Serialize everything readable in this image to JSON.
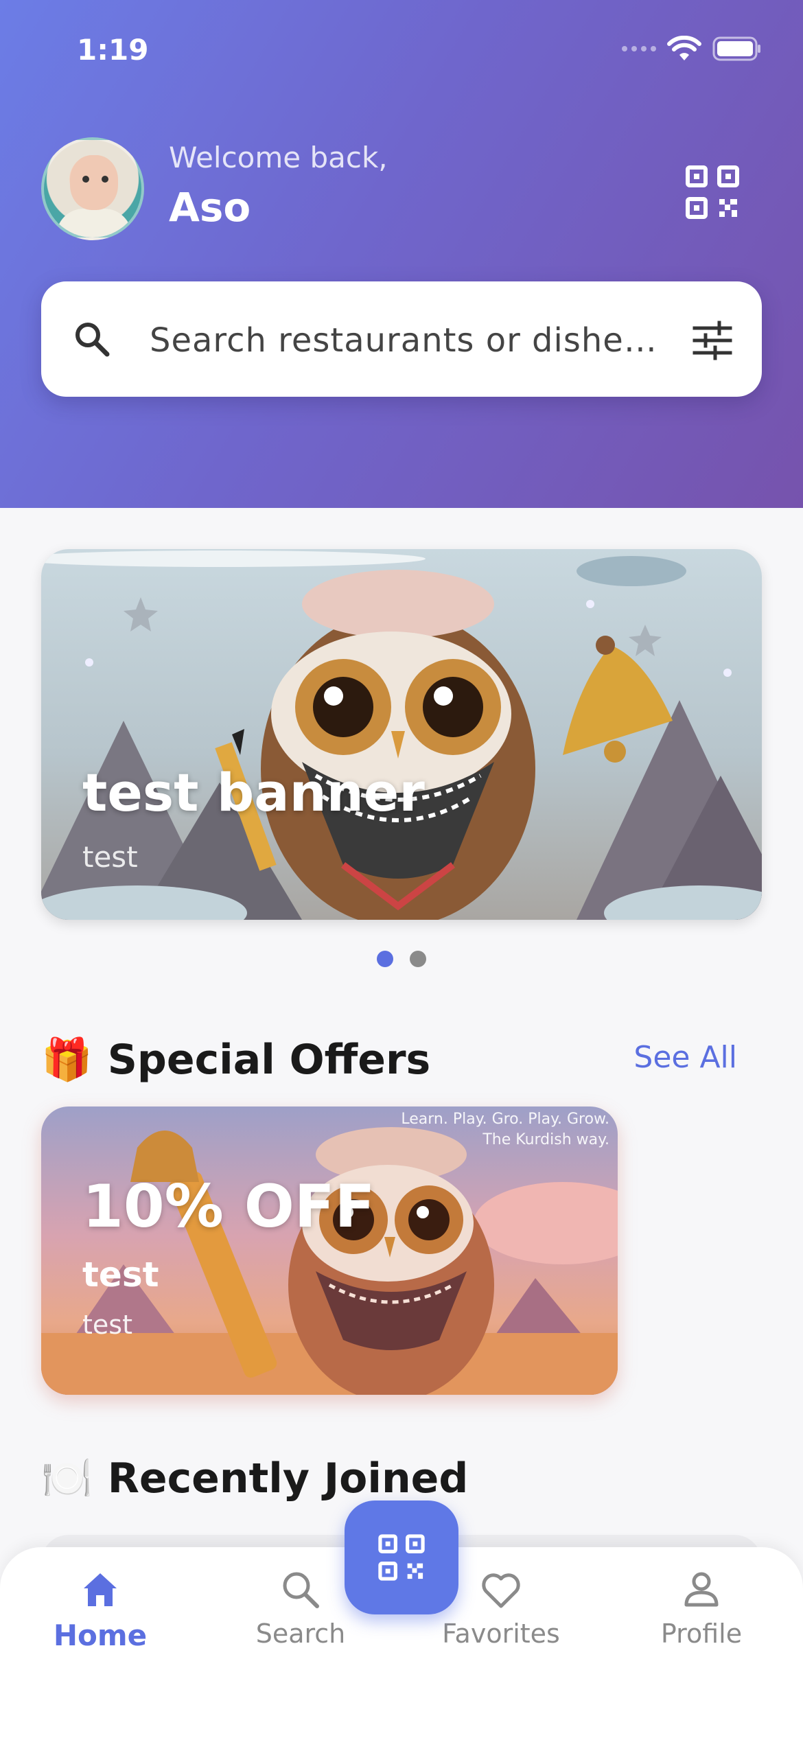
{
  "status_bar": {
    "time": "1:19"
  },
  "header": {
    "welcome": "Welcome back,",
    "username": "Aso"
  },
  "search": {
    "placeholder": "Search restaurants or dishe…"
  },
  "banner": {
    "title": "test banner",
    "subtitle": "test",
    "active_index": 0,
    "page_count": 2
  },
  "special_offers": {
    "emoji": "🎁",
    "title": "Special Offers",
    "see_all": "See All",
    "offers": [
      {
        "discount": "10% OFF",
        "title": "test",
        "subtitle": "test",
        "tagline": [
          "Learn. Play. Gro. Play. Grow.",
          "The Kurdish way."
        ]
      }
    ]
  },
  "recently_joined": {
    "emoji": "🍽️",
    "title": "Recently Joined"
  },
  "bottom_nav": {
    "items": [
      {
        "label": "Home",
        "icon": "home-icon",
        "active": true
      },
      {
        "label": "Search",
        "icon": "search-icon",
        "active": false
      },
      {
        "label": "Favorites",
        "icon": "heart-icon",
        "active": false
      },
      {
        "label": "Profile",
        "icon": "person-icon",
        "active": false
      }
    ],
    "fab_icon": "qr-scan-icon"
  },
  "colors": {
    "accent": "#5b6fe0",
    "header_gradient_start": "#6c7de6",
    "header_gradient_end": "#7653ad",
    "inactive": "#8a8a8a"
  }
}
